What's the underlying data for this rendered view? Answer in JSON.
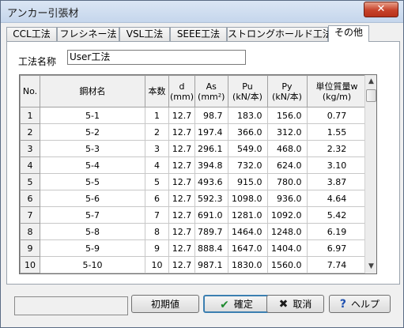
{
  "window": {
    "title": "アンカー引張材",
    "close_glyph": "✕"
  },
  "tabs": [
    {
      "label": "CCL工法"
    },
    {
      "label": "フレシネー法"
    },
    {
      "label": "VSL工法"
    },
    {
      "label": "SEEE工法"
    },
    {
      "label": "ストロングホールド工法"
    },
    {
      "label": "その他",
      "active": true
    }
  ],
  "form": {
    "method_label": "工法名称",
    "method_value": "User工法"
  },
  "table": {
    "headers": {
      "no": "No.",
      "name": "鋼材名",
      "count": "本数",
      "d": "d",
      "d_unit": "(mm)",
      "as": "As",
      "as_unit": "(mm²)",
      "pu": "Pu",
      "pu_unit": "(kN/本)",
      "py": "Py",
      "py_unit": "(kN/本)",
      "w": "単位質量w",
      "w_unit": "(kg/m)"
    },
    "rows": [
      [
        "1",
        "5-1",
        "1",
        "12.7",
        "98.7",
        "183.0",
        "156.0",
        "0.77"
      ],
      [
        "2",
        "5-2",
        "2",
        "12.7",
        "197.4",
        "366.0",
        "312.0",
        "1.55"
      ],
      [
        "3",
        "5-3",
        "3",
        "12.7",
        "296.1",
        "549.0",
        "468.0",
        "2.32"
      ],
      [
        "4",
        "5-4",
        "4",
        "12.7",
        "394.8",
        "732.0",
        "624.0",
        "3.10"
      ],
      [
        "5",
        "5-5",
        "5",
        "12.7",
        "493.6",
        "915.0",
        "780.0",
        "3.87"
      ],
      [
        "6",
        "5-6",
        "6",
        "12.7",
        "592.3",
        "1098.0",
        "936.0",
        "4.64"
      ],
      [
        "7",
        "5-7",
        "7",
        "12.7",
        "691.0",
        "1281.0",
        "1092.0",
        "5.42"
      ],
      [
        "8",
        "5-8",
        "8",
        "12.7",
        "789.7",
        "1464.0",
        "1248.0",
        "6.19"
      ],
      [
        "9",
        "5-9",
        "9",
        "12.7",
        "888.4",
        "1647.0",
        "1404.0",
        "6.97"
      ],
      [
        "10",
        "5-10",
        "10",
        "12.7",
        "987.1",
        "1830.0",
        "1560.0",
        "7.74"
      ]
    ]
  },
  "buttons": {
    "initial": "初期値",
    "ok": "確定",
    "ok_icon": "✔",
    "cancel": "取消",
    "cancel_icon": "✖",
    "help": "ヘルプ",
    "help_icon": "?"
  },
  "colors": {
    "ok_icon": "#1e8a2e",
    "cancel_icon": "#1a1a1a",
    "help_icon": "#1d4fb0",
    "close_button": "#c7422a"
  }
}
